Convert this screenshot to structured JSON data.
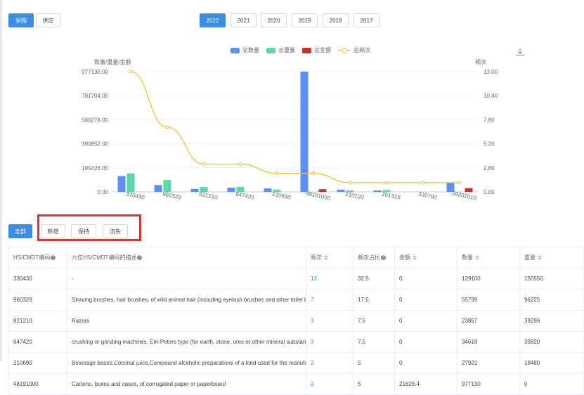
{
  "top_tabs": [
    "采购",
    "供应"
  ],
  "years": [
    "2022",
    "2021",
    "2020",
    "2019",
    "2018",
    "2017"
  ],
  "filter_tabs": [
    "全部",
    "新增",
    "保持",
    "流失"
  ],
  "chart_data": {
    "type": "bar",
    "legend": [
      "总数量",
      "总重量",
      "总金额",
      "总频次"
    ],
    "ylabel_left": "数量/重量/金额",
    "ylabel_right": "频次",
    "y_left_ticks": [
      "0.00",
      "195426.00",
      "390852.00",
      "586278.00",
      "781704.00",
      "977130.00"
    ],
    "y_right_ticks": [
      "0.00",
      "2.60",
      "5.20",
      "7.80",
      "10.40",
      "13.00"
    ],
    "ylim_left": [
      0,
      977130
    ],
    "ylim_right": [
      0,
      13
    ],
    "categories": [
      "330430",
      "960329",
      "821210",
      "847420",
      "210690",
      "48191000",
      "210120",
      "251319",
      "330790",
      "39202010"
    ],
    "series": [
      {
        "name": "总数量",
        "kind": "bar",
        "color": "#5b8ff9",
        "values": [
          129100,
          55799,
          23897,
          34618,
          27921,
          977130,
          18000,
          12000,
          0,
          75000
        ]
      },
      {
        "name": "总重量",
        "kind": "bar",
        "color": "#5ad8a6",
        "values": [
          150556,
          96225,
          39299,
          39820,
          18480,
          0,
          12000,
          15000,
          0,
          0
        ]
      },
      {
        "name": "总金额",
        "kind": "bar",
        "color": "#c8312f",
        "values": [
          0,
          0,
          0,
          0,
          0,
          21626.4,
          0,
          0,
          0,
          30000
        ]
      },
      {
        "name": "总频次",
        "kind": "line",
        "color": "#f2c12e",
        "axis": "right",
        "values": [
          13,
          7,
          3,
          3,
          2,
          2,
          1,
          1,
          1,
          1
        ]
      }
    ]
  },
  "table": {
    "headers": [
      "HS/CMDT编码",
      "六位HS/CMDT编码的描述",
      "频次",
      "频次占比",
      "金额",
      "数量",
      "重量"
    ],
    "rows": [
      [
        "330430",
        "-",
        "13",
        "32.5",
        "0",
        "129100",
        "150556"
      ],
      [
        "960329",
        "Shaving brushes, hair brushes, of wild animal hair (including eyelash brushes and other toilet brushes",
        "7",
        "17.5",
        "0",
        "55799",
        "96225"
      ],
      [
        "821210",
        "Razors",
        "3",
        "7.5",
        "0",
        "23897",
        "39299"
      ],
      [
        "847420",
        "crushing or grinding machines, Em-Peters type (for earth, stone, ores or other mineral substances in",
        "3",
        "7.5",
        "0",
        "34618",
        "39820"
      ],
      [
        "210690",
        "Beverage bases,Coconut juice,Compound alcoholic preparations of a kind used for the manufacture",
        "2",
        "5",
        "0",
        "27921",
        "18480"
      ],
      [
        "48191000",
        "Cartons, boxes and cases, of corrugated paper or paperboard",
        "2",
        "5",
        "21626.4",
        "977130",
        "0"
      ]
    ]
  }
}
